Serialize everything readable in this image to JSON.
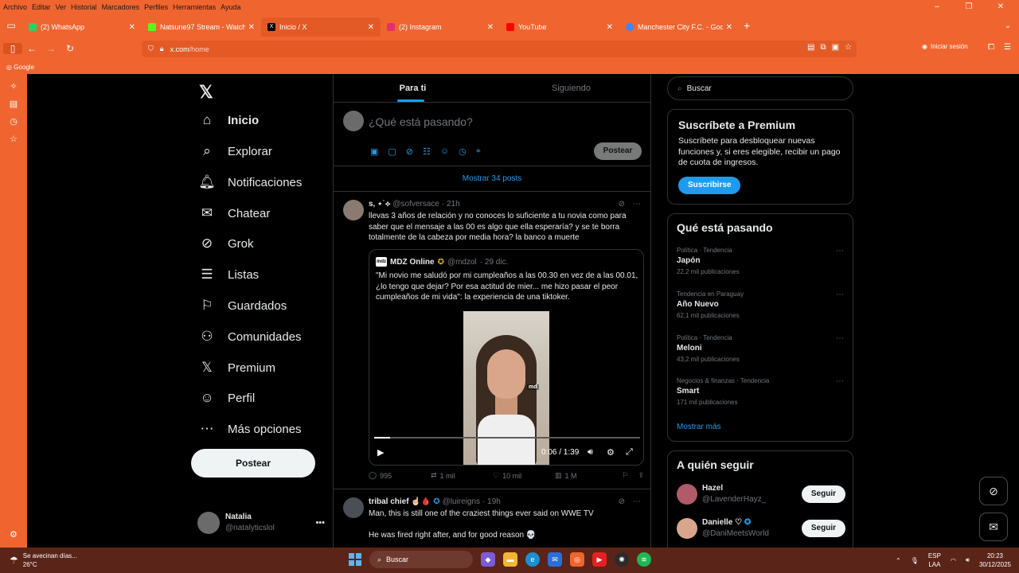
{
  "menubar": [
    "Archivo",
    "Editar",
    "Ver",
    "Historial",
    "Marcadores",
    "Perfiles",
    "Herramientas",
    "Ayuda"
  ],
  "tabs": [
    {
      "label": "(2) WhatsApp",
      "color": "#25d366",
      "icon": "whatsapp-icon"
    },
    {
      "label": "Natsune97 Stream - Watch Live",
      "color": "#53fc18",
      "icon": "kick-icon"
    },
    {
      "label": "Inicio / X",
      "color": "#000000",
      "icon": "x-icon",
      "active": true
    },
    {
      "label": "(2) Instagram",
      "color": "#e1306c",
      "icon": "instagram-icon"
    },
    {
      "label": "YouTube",
      "color": "#ff0000",
      "icon": "youtube-icon"
    },
    {
      "label": "Manchester City F.C. - Google S",
      "color": "#4285f4",
      "icon": "google-icon"
    }
  ],
  "address": {
    "host": "x.com",
    "path": "/home"
  },
  "signin": "Iniciar sesión",
  "bookmark": "Google",
  "nav": [
    {
      "label": "Inicio",
      "icon": "home-icon",
      "glyph": "⌂"
    },
    {
      "label": "Explorar",
      "icon": "search-icon",
      "glyph": "⌕"
    },
    {
      "label": "Notificaciones",
      "icon": "bell-icon",
      "glyph": "🔔︎"
    },
    {
      "label": "Chatear",
      "icon": "mail-icon",
      "glyph": "✉"
    },
    {
      "label": "Grok",
      "icon": "grok-icon",
      "glyph": "⊘"
    },
    {
      "label": "Listas",
      "icon": "list-icon",
      "glyph": "☰"
    },
    {
      "label": "Guardados",
      "icon": "bookmark-icon",
      "glyph": "⚐"
    },
    {
      "label": "Comunidades",
      "icon": "communities-icon",
      "glyph": "⚇"
    },
    {
      "label": "Premium",
      "icon": "x-premium-icon",
      "glyph": "𝕏"
    },
    {
      "label": "Perfil",
      "icon": "profile-icon",
      "glyph": "☺"
    },
    {
      "label": "Más opciones",
      "icon": "more-icon",
      "glyph": "⋯"
    }
  ],
  "post_button": "Postear",
  "account": {
    "name": "Natalia",
    "handle": "@natalyticslol"
  },
  "timeline": {
    "tabs": [
      "Para ti",
      "Siguiendo"
    ],
    "composer_placeholder": "¿Qué está pasando?",
    "composer_button": "Postear",
    "show_more": "Mostrar 34 posts"
  },
  "tweet1": {
    "name": "s, ⋆˙⟡",
    "handle": "@sofversace",
    "time": "· 21h",
    "text": "llevas 3 años de relación y no conoces lo suficiente a tu novia como para saber que el mensaje a las 00 es algo que ella esperaría? y se te borra totalmente de la cabeza por media hora? la banco a muerte",
    "quote": {
      "name": "MDZ Online",
      "handle": "@mdzol",
      "time": "· 29 dic.",
      "text": "\"Mi novio me saludó por mi cumpleaños a las 00.30 en vez de a las 00.01, ¿lo tengo que dejar? Por esa actitud de mier... me hizo pasar el peor cumpleaños de mi vida\": la experiencia de una tiktoker.",
      "watermark": "md",
      "video_time": "0:06 / 1:39",
      "progress": 0.06
    },
    "replies": "995",
    "reposts": "1 mil",
    "likes": "10 mil",
    "views": "1 M"
  },
  "tweet2": {
    "name": "tribal chief ☝🏻🩸",
    "handle": "@luireigns",
    "time": "· 19h",
    "text1": "Man, this is still one of the craziest things ever said on WWE TV",
    "text2": "He was fired right after, and for good reason 💀"
  },
  "right": {
    "search_placeholder": "Buscar",
    "premium": {
      "title": "Suscríbete a Premium",
      "body": "Suscríbete para desbloquear nuevas funciones y, si eres elegible, recibir un pago de cuota de ingresos.",
      "button": "Suscribirse"
    },
    "trends_title": "Qué está pasando",
    "trends": [
      {
        "context": "Política · Tendencia",
        "title": "Japón",
        "count": "22,2 mil publicaciones"
      },
      {
        "context": "Tendencia en Paraguay",
        "title": "Año Nuevo",
        "count": "62,1 mil publicaciones"
      },
      {
        "context": "Política · Tendencia",
        "title": "Meloni",
        "count": "43,2 mil publicaciones"
      },
      {
        "context": "Negocios & finanzas · Tendencia",
        "title": "Smart",
        "count": "171 mil publicaciones"
      }
    ],
    "show_more": "Mostrar más",
    "follow_title": "A quién seguir",
    "follow": [
      {
        "name": "Hazel",
        "handle": "@LavenderHayz_",
        "button": "Seguir"
      },
      {
        "name": "Danielle ♡",
        "handle": "@DaniMeetsWorld",
        "button": "Seguir"
      }
    ]
  },
  "taskbar": {
    "weather_text": "Se avecinan días...",
    "temp": "26°C",
    "search": "Buscar",
    "lang1": "ESP",
    "lang2": "LAA",
    "time": "20:23",
    "date": "30/12/2025"
  },
  "colors": {
    "accent": "#1d9bf0",
    "browser": "#f0652f",
    "taskbar": "#5a2418"
  }
}
